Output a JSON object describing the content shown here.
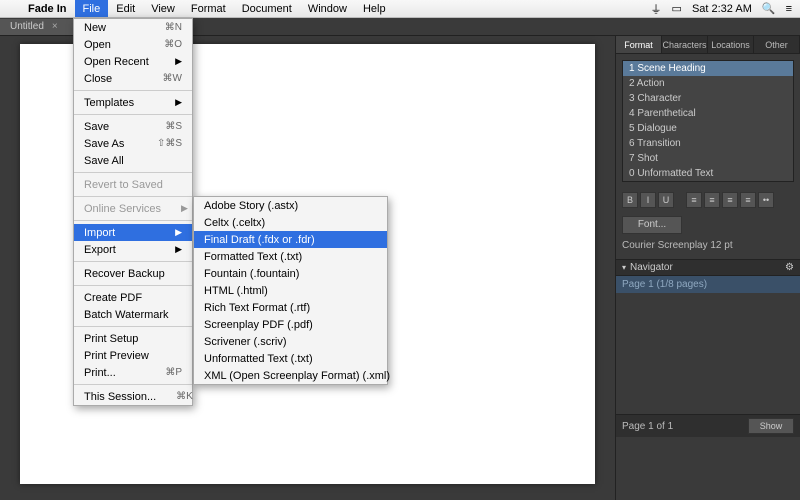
{
  "menubar": {
    "app": "Fade In",
    "items": [
      "File",
      "Edit",
      "View",
      "Format",
      "Document",
      "Window",
      "Help"
    ],
    "selected": "File",
    "clock": "Sat 2:32 AM"
  },
  "tab": {
    "title": "Untitled"
  },
  "file_menu": {
    "items": [
      {
        "label": "New",
        "shortcut": "⌘N"
      },
      {
        "label": "Open",
        "shortcut": "⌘O"
      },
      {
        "label": "Open Recent",
        "submenu": true
      },
      {
        "label": "Close",
        "shortcut": "⌘W"
      },
      {
        "sep": true
      },
      {
        "label": "Templates",
        "submenu": true
      },
      {
        "sep": true
      },
      {
        "label": "Save",
        "shortcut": "⌘S"
      },
      {
        "label": "Save As",
        "shortcut": "⇧⌘S"
      },
      {
        "label": "Save All"
      },
      {
        "sep": true
      },
      {
        "label": "Revert to Saved",
        "disabled": true
      },
      {
        "sep": true
      },
      {
        "label": "Online Services",
        "submenu": true,
        "disabled": true
      },
      {
        "sep": true
      },
      {
        "label": "Import",
        "submenu": true,
        "selected": true
      },
      {
        "label": "Export",
        "submenu": true
      },
      {
        "sep": true
      },
      {
        "label": "Recover Backup"
      },
      {
        "sep": true
      },
      {
        "label": "Create PDF"
      },
      {
        "label": "Batch Watermark"
      },
      {
        "sep": true
      },
      {
        "label": "Print Setup"
      },
      {
        "label": "Print Preview"
      },
      {
        "label": "Print...",
        "shortcut": "⌘P"
      },
      {
        "sep": true
      },
      {
        "label": "This Session...",
        "shortcut": "⌘K"
      }
    ]
  },
  "import_menu": {
    "items": [
      {
        "label": "Adobe Story (.astx)"
      },
      {
        "label": "Celtx (.celtx)"
      },
      {
        "label": "Final Draft (.fdx or .fdr)",
        "selected": true
      },
      {
        "label": "Formatted Text (.txt)"
      },
      {
        "label": "Fountain (.fountain)"
      },
      {
        "label": "HTML (.html)"
      },
      {
        "label": "Rich Text Format (.rtf)"
      },
      {
        "label": "Screenplay PDF (.pdf)"
      },
      {
        "label": "Scrivener (.scriv)"
      },
      {
        "label": "Unformatted Text (.txt)"
      },
      {
        "label": "XML (Open Screenplay Format) (.xml)"
      }
    ]
  },
  "right": {
    "tabs": [
      "Format",
      "Characters",
      "Locations",
      "Other"
    ],
    "active_tab": "Format",
    "formats": [
      "1 Scene Heading",
      "2 Action",
      "3 Character",
      "4 Parenthetical",
      "5 Dialogue",
      "6 Transition",
      "7 Shot",
      "0 Unformatted Text"
    ],
    "active_format": 0,
    "style_buttons": [
      "B",
      "I",
      "U"
    ],
    "align_buttons": [
      "≡",
      "≡",
      "≡",
      "≡",
      "••"
    ],
    "font_btn": "Font...",
    "font_label": "Courier Screenplay 12 pt"
  },
  "navigator": {
    "title": "Navigator",
    "page_label": "Page 1 (1/8 pages)",
    "footer": "Page 1 of 1",
    "show_btn": "Show"
  }
}
